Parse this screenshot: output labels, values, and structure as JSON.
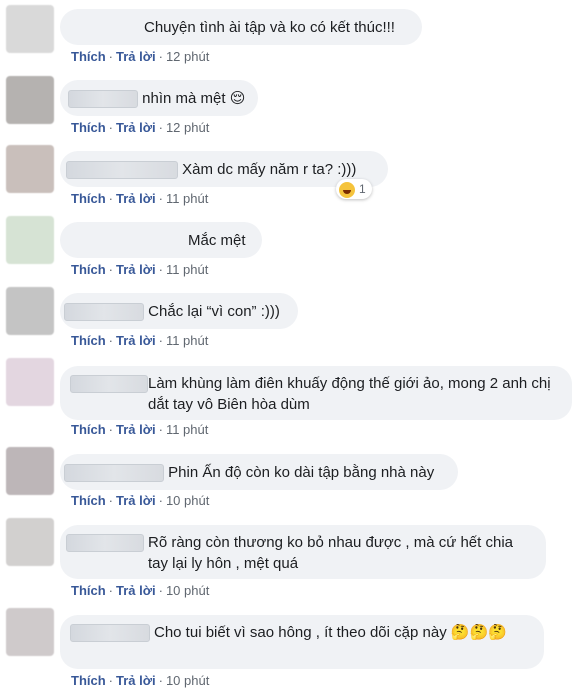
{
  "colors": {
    "link": "#385898",
    "muted": "#606770",
    "bubble": "#f0f2f5",
    "text": "#1c1e21"
  },
  "icons": {
    "thinking": "thinking-face-emoji",
    "relieved": "relieved-face-emoji",
    "laughing": "laughing-face-emoji"
  },
  "comments": [
    {
      "text": "Chuyện tình ài tập và ko có kết thúc!!!",
      "like": "Thích",
      "reply": "Trả lời",
      "time": "12 phút"
    },
    {
      "text": "nhìn mà mệt 😌",
      "like": "Thích",
      "reply": "Trả lời",
      "time": "12 phút"
    },
    {
      "text": "Xàm dc mấy năm r ta? :)))",
      "like": "Thích",
      "reply": "Trả lời",
      "time": "11 phút",
      "reaction_count": "1"
    },
    {
      "text": "Mắc mệt",
      "like": "Thích",
      "reply": "Trả lời",
      "time": "11 phút"
    },
    {
      "text": "Chắc lại “vì con” :)))",
      "like": "Thích",
      "reply": "Trả lời",
      "time": "11 phút"
    },
    {
      "text": "Làm khùng làm điên khuấy động thế giới ảo, mong 2 anh chị dắt tay vô Biên hòa dùm",
      "like": "Thích",
      "reply": "Trả lời",
      "time": "11 phút"
    },
    {
      "text": "Phin Ấn độ còn ko dài tập bằng nhà này",
      "like": "Thích",
      "reply": "Trả lời",
      "time": "10 phút"
    },
    {
      "text": "Rõ ràng còn thương ko bỏ nhau được , mà cứ hết chia tay lại ly hôn , mệt quá",
      "like": "Thích",
      "reply": "Trả lời",
      "time": "10 phút"
    },
    {
      "text": "Cho tui biết vì sao hông , ít theo dõi cặp này 🤔🤔🤔",
      "like": "Thích",
      "reply": "Trả lời",
      "time": "10 phút"
    }
  ]
}
